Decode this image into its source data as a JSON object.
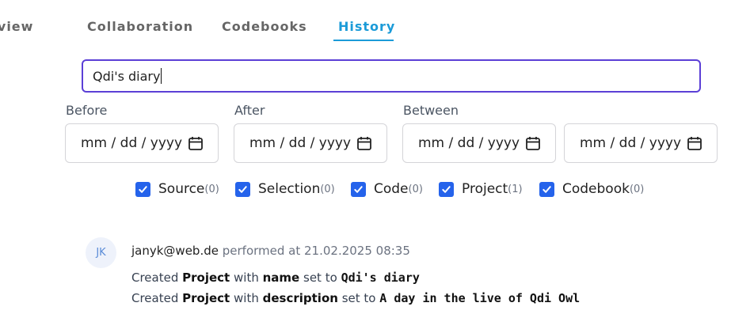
{
  "tabs": [
    {
      "label": "rview"
    },
    {
      "label": "Collaboration"
    },
    {
      "label": "Codebooks"
    },
    {
      "label": "History",
      "active": true
    }
  ],
  "search": {
    "value": "Qdi's diary"
  },
  "date_filters": {
    "before_label": "Before",
    "after_label": "After",
    "between_label": "Between",
    "placeholder": "mm / dd / yyyy"
  },
  "type_filters": [
    {
      "label": "Source",
      "count": "(0)",
      "checked": true
    },
    {
      "label": "Selection",
      "count": "(0)",
      "checked": true
    },
    {
      "label": "Code",
      "count": "(0)",
      "checked": true
    },
    {
      "label": "Project",
      "count": "(1)",
      "checked": true
    },
    {
      "label": "Codebook",
      "count": "(0)",
      "checked": true
    }
  ],
  "history": [
    {
      "initials": "JK",
      "user": "janyk@web.de",
      "performed": "performed at 21.02.2025 08:35",
      "changes": [
        {
          "action": "Created",
          "entity": "Project",
          "w1": "with",
          "field": "name",
          "w2": "set to",
          "value": "Qdi's diary"
        },
        {
          "action": "Created",
          "entity": "Project",
          "w1": "with",
          "field": "description",
          "w2": "set to",
          "value": "A day in the live of Qdi Owl"
        }
      ]
    }
  ],
  "colors": {
    "accent": "#1b9bd8",
    "focus_border": "#5b3fd6",
    "checkbox": "#2563eb"
  },
  "icons": [
    "calendar-icon",
    "checkmark-icon"
  ]
}
